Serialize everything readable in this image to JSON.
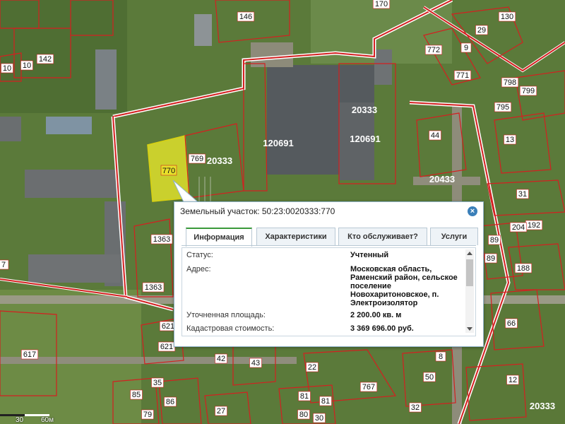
{
  "map": {
    "highlight_label": "770",
    "plot_labels": [
      "146",
      "170",
      "130",
      "29",
      "9",
      "772",
      "771",
      "142",
      "10",
      "10",
      "798",
      "799",
      "795",
      "44",
      "13",
      "20433",
      "31",
      "89",
      "89",
      "188",
      "20333",
      "120691",
      "120691",
      "20333",
      "769",
      "1363",
      "1363",
      "621",
      "621",
      "617",
      "42",
      "43",
      "22",
      "767",
      "8",
      "50",
      "12",
      "66",
      "35",
      "85",
      "86",
      "79",
      "27",
      "81",
      "81",
      "80",
      "30",
      "32",
      "20333",
      "192",
      "204",
      "7"
    ],
    "scale": {
      "left": "30",
      "right": "60м"
    }
  },
  "popup": {
    "title": "Земельный участок: 50:23:0020333:770",
    "tabs": [
      "Информация",
      "Характеристики",
      "Кто обслуживает?",
      "Услуги"
    ],
    "fields": [
      {
        "label": "Статус:",
        "value": "Учтенный"
      },
      {
        "label": "Адрес:",
        "value": "Московская область, Раменский район, сельское поселение Новохаритоновское, п. Электроизолятор"
      },
      {
        "label": "Уточненная площадь:",
        "value": "2 200.00 кв. м"
      },
      {
        "label": "Кадастровая стоимость:",
        "value": "3 369 696.00 руб."
      }
    ]
  },
  "colors": {
    "tab_active": "#3a9a3a",
    "highlight": "#e6e62a",
    "boundary": "#d32020"
  },
  "icons": {
    "close": "close-icon"
  }
}
